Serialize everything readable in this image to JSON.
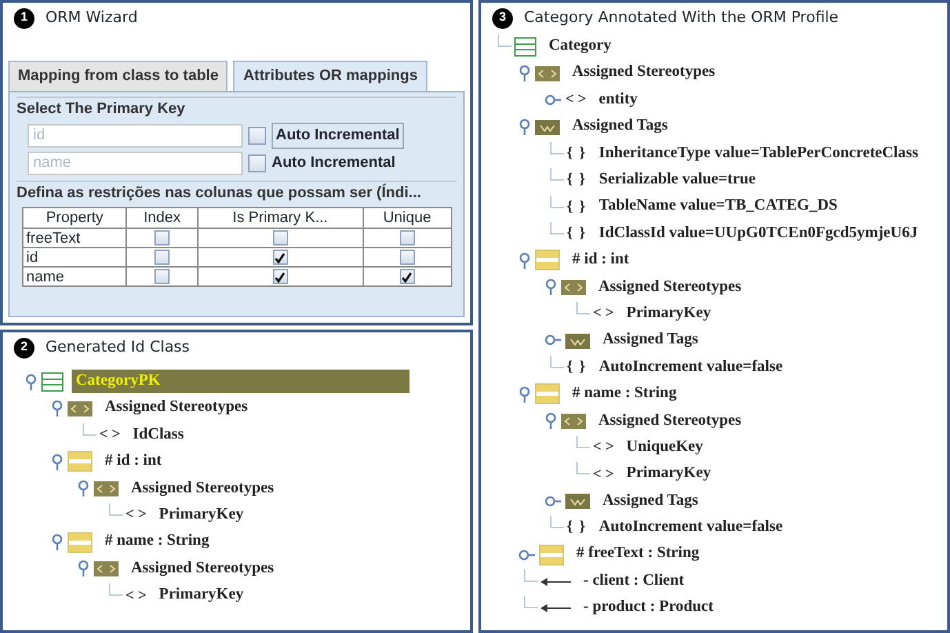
{
  "wizard": {
    "badge": "1",
    "title": "ORM Wizard",
    "tabs": [
      {
        "label": "Mapping from class to table",
        "selected": false
      },
      {
        "label": "Attributes OR mappings",
        "selected": true
      }
    ],
    "primary_key": {
      "title": "Select The Primary Key",
      "fields": [
        {
          "placeholder": "id",
          "checkbox_label": "Auto Incremental",
          "checked": false
        },
        {
          "placeholder": "name",
          "checkbox_label": "Auto Incremental",
          "checked": false
        }
      ]
    },
    "constraints": {
      "title": "Defina as restrições nas colunas que possam ser (Índi...",
      "columns": [
        "Property",
        "Index",
        "Is Primary K...",
        "Unique"
      ],
      "rows": [
        {
          "property": "freeText",
          "index": false,
          "primary_key": false,
          "unique": false
        },
        {
          "property": "id",
          "index": false,
          "primary_key": true,
          "unique": false
        },
        {
          "property": "name",
          "index": false,
          "primary_key": true,
          "unique": true
        }
      ]
    }
  },
  "id_class": {
    "badge": "2",
    "title": "Generated Id Class",
    "tree": [
      {
        "kind": "class",
        "label": "CategoryPK",
        "selected": true,
        "expanded": true,
        "children": [
          {
            "kind": "stereotypes",
            "label": "Assigned Stereotypes",
            "expanded": true,
            "children": [
              {
                "kind": "stereotype",
                "marker": "< >",
                "label": "IdClass"
              }
            ]
          },
          {
            "kind": "attribute",
            "label": "# id : int",
            "expanded": true,
            "children": [
              {
                "kind": "stereotypes",
                "label": "Assigned Stereotypes",
                "expanded": true,
                "children": [
                  {
                    "kind": "stereotype",
                    "marker": "< >",
                    "label": "PrimaryKey"
                  }
                ]
              }
            ]
          },
          {
            "kind": "attribute",
            "label": "# name : String",
            "expanded": true,
            "children": [
              {
                "kind": "stereotypes",
                "label": "Assigned Stereotypes",
                "expanded": true,
                "children": [
                  {
                    "kind": "stereotype",
                    "marker": "< >",
                    "label": "PrimaryKey"
                  }
                ]
              }
            ]
          }
        ]
      }
    ]
  },
  "annotated": {
    "badge": "3",
    "title": "Category Annotated With the ORM Profile",
    "tree": [
      {
        "kind": "class",
        "label": "Category",
        "selected": false,
        "children": [
          {
            "kind": "stereotypes",
            "label": "Assigned Stereotypes",
            "expanded": true,
            "children": [
              {
                "kind": "stereotype",
                "marker": "< >",
                "label": "entity",
                "expanded": false
              }
            ]
          },
          {
            "kind": "tags",
            "label": "Assigned Tags",
            "expanded": true,
            "children": [
              {
                "kind": "tag",
                "marker": "{ }",
                "label": "InheritanceType value=TablePerConcreteClass"
              },
              {
                "kind": "tag",
                "marker": "{ }",
                "label": "Serializable value=true"
              },
              {
                "kind": "tag",
                "marker": "{ }",
                "label": "TableName value=TB_CATEG_DS"
              },
              {
                "kind": "tag",
                "marker": "{ }",
                "label": "IdClassId value=UUpG0TCEn0Fgcd5ymjeU6J"
              }
            ]
          },
          {
            "kind": "attribute",
            "label": "# id : int",
            "expanded": true,
            "children": [
              {
                "kind": "stereotypes",
                "label": "Assigned Stereotypes",
                "expanded": true,
                "children": [
                  {
                    "kind": "stereotype",
                    "marker": "< >",
                    "label": "PrimaryKey"
                  }
                ]
              },
              {
                "kind": "tags",
                "label": "Assigned Tags",
                "expanded": false
              },
              {
                "kind": "tag",
                "marker": "{ }",
                "label": "AutoIncrement value=false"
              }
            ]
          },
          {
            "kind": "attribute",
            "label": "# name : String",
            "expanded": true,
            "children": [
              {
                "kind": "stereotypes",
                "label": "Assigned Stereotypes",
                "expanded": true,
                "children": [
                  {
                    "kind": "stereotype",
                    "marker": "< >",
                    "label": "UniqueKey"
                  },
                  {
                    "kind": "stereotype",
                    "marker": "< >",
                    "label": "PrimaryKey"
                  }
                ]
              },
              {
                "kind": "tags",
                "label": "Assigned Tags",
                "expanded": false
              },
              {
                "kind": "tag",
                "marker": "{ }",
                "label": "AutoIncrement value=false"
              }
            ]
          },
          {
            "kind": "attribute",
            "label": "# freeText : String",
            "expanded": false
          },
          {
            "kind": "association",
            "label": "- client : Client"
          },
          {
            "kind": "association",
            "label": "- product : Product"
          }
        ]
      }
    ]
  }
}
